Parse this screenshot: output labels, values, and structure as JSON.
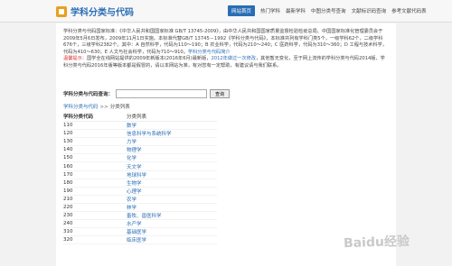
{
  "header": {
    "logo_text": "学科分类与代码",
    "nav": [
      {
        "label": "网站首页",
        "active": true
      },
      {
        "label": "热门学科"
      },
      {
        "label": "最新学科"
      },
      {
        "label": "中图分类号查询"
      },
      {
        "label": "文献标识码查询"
      },
      {
        "label": "参考文献代码表"
      }
    ]
  },
  "intro": {
    "line1": "学科分类与代码国家标准：《中华人民共和国国家标准 GB/T 13745-2009》，由中华人民共和国国家质量监督检验检疫总局、中国国家标准化管理委员会于2009年5月6日发布，2009年11月1日实施。本标准代替GB/T 13745－1992《学科分类与代码》，本标准共列有学科门类5个，一级学科62个，二级学科676个，三级学科2382个。其中：A 自然科学，代码为110～190；B 农业科学，代码为210～240；C 医药科学，代码为310～360；D 工程与技术科学，代码为410～630；E 人文与社会科学，代码为710～910。",
    "link": "学科分类与代码简介",
    "tip_label": "温馨提示",
    "tip_text": "：国学全在线网站提供的2009年新版本(2016年6月)最新版，",
    "tip_link": "2012年做过一次修改",
    "tip_rest": "，其他暂无变化，至于网上流传的学科分类与代码2014版、学科分类与代码2016年版等版本都是假冒的，请以本网站为准，有对您有一定帮助，有建议请与我们联系。"
  },
  "search": {
    "label": "学科分类与代码查询：",
    "placeholder": "",
    "button": "查询"
  },
  "breadcrumb": {
    "root": "学科分类与代码",
    "sep": ">>",
    "current": "分类列表"
  },
  "table": {
    "headers": [
      "学科分类代码",
      "分类列表"
    ],
    "rows": [
      [
        "110",
        "数学"
      ],
      [
        "120",
        "信息科学与系统科学"
      ],
      [
        "130",
        "力学"
      ],
      [
        "140",
        "物理学"
      ],
      [
        "150",
        "化学"
      ],
      [
        "160",
        "天文学"
      ],
      [
        "170",
        "地球科学"
      ],
      [
        "180",
        "生物学"
      ],
      [
        "190",
        "心理学"
      ],
      [
        "210",
        "农学"
      ],
      [
        "220",
        "林学"
      ],
      [
        "230",
        "畜牧、兽医科学"
      ],
      [
        "240",
        "水产学"
      ],
      [
        "310",
        "基础医学"
      ],
      [
        "320",
        "临床医学"
      ]
    ]
  },
  "watermark": "Baidu经验"
}
